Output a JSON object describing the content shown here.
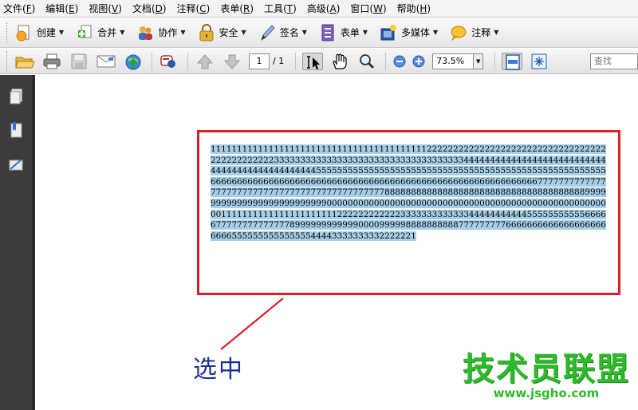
{
  "menu": [
    {
      "label": "文件",
      "key": "F"
    },
    {
      "label": "编辑",
      "key": "E"
    },
    {
      "label": "视图",
      "key": "V"
    },
    {
      "label": "文档",
      "key": "D"
    },
    {
      "label": "注释",
      "key": "C"
    },
    {
      "label": "表单",
      "key": "R"
    },
    {
      "label": "工具",
      "key": "T"
    },
    {
      "label": "高级",
      "key": "A"
    },
    {
      "label": "窗口",
      "key": "W"
    },
    {
      "label": "帮助",
      "key": "H"
    }
  ],
  "toolbar": {
    "create": "创建",
    "combine": "合并",
    "collaborate": "协作",
    "secure": "安全",
    "sign": "签名",
    "forms": "表单",
    "multimedia": "多媒体",
    "comment": "注释"
  },
  "nav": {
    "page_current": "1",
    "page_total": "/ 1",
    "zoom": "73.5%",
    "search_placeholder": "查找"
  },
  "document": {
    "selected_text": "111111111111111111111111111111111111111112222222222222222222222222222222222222222222222333333333333333333333333333333333333444444444444444444444444444444444444444444444445555555555555555555555555555555555555555555555555555555666666666666666666666666666666666666666666666666666666666666667777777777777777777777777777777777777777777777888888888888888888888888888888888888889999999999999999999999999900000000000000000000000000000000000000000000000000000001111111111111111111111222222222222333333333333344444444444555555555556666677777777777777899999999999900009999988888888887777777776666666666666666666666655555555555555544443333333332222221",
    "callout": "选中"
  },
  "watermark": {
    "title": "技术员联盟",
    "url": "www.jsgho.com"
  },
  "colors": {
    "selection": "#a7cee8",
    "highlight_border": "#d9202a",
    "callout": "#1a2f9a",
    "watermark": "#2fb92b"
  }
}
